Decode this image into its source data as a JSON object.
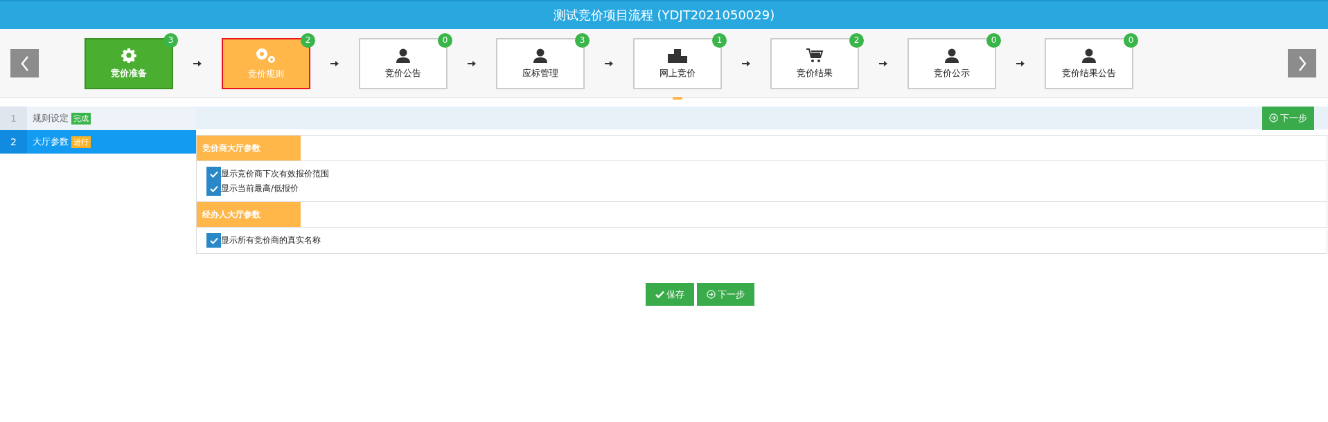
{
  "title": "测试竞价项目流程 (YDJT2021050029)",
  "steps": [
    {
      "label": "竞价准备",
      "count": "3",
      "kind": "gear",
      "done": true,
      "selected": false
    },
    {
      "label": "竞价规则",
      "count": "2",
      "kind": "gears",
      "done": false,
      "selected": true
    },
    {
      "label": "竞价公告",
      "count": "0",
      "kind": "person",
      "done": false,
      "selected": false
    },
    {
      "label": "应标管理",
      "count": "3",
      "kind": "person",
      "done": false,
      "selected": false
    },
    {
      "label": "网上竞价",
      "count": "1",
      "kind": "podium",
      "done": false,
      "selected": false,
      "marked": true
    },
    {
      "label": "竞价结果",
      "count": "2",
      "kind": "cart",
      "done": false,
      "selected": false
    },
    {
      "label": "竞价公示",
      "count": "0",
      "kind": "person",
      "done": false,
      "selected": false
    },
    {
      "label": "竞价结果公告",
      "count": "0",
      "kind": "person",
      "done": false,
      "selected": false
    }
  ],
  "sidebar": {
    "items": [
      {
        "number": "1",
        "label": "规则设定",
        "badge": "完成",
        "done": true,
        "selected": false
      },
      {
        "number": "2",
        "label": "大厅参数",
        "badge": "进行",
        "done": false,
        "selected": true
      }
    ]
  },
  "top_next_button": "下一步",
  "sections": [
    {
      "title": "竞价商大厅参数",
      "options": [
        {
          "label": "显示竞价商下次有效报价范围",
          "checked": true
        },
        {
          "label": "显示当前最高/低报价",
          "checked": true
        }
      ]
    },
    {
      "title": "经办人大厅参数",
      "options": [
        {
          "label": "显示所有竞价商的真实名称",
          "checked": true
        }
      ]
    }
  ],
  "buttons": [
    {
      "kind": "save",
      "label": "保存"
    },
    {
      "kind": "next",
      "label": "下一步"
    }
  ]
}
